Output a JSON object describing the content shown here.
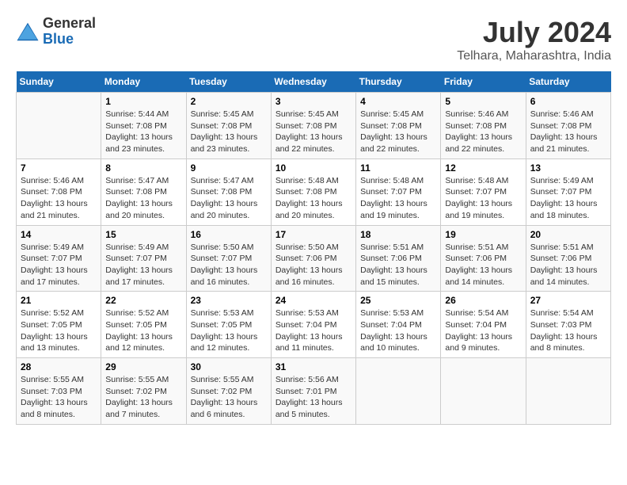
{
  "header": {
    "logo_general": "General",
    "logo_blue": "Blue",
    "main_title": "July 2024",
    "sub_title": "Telhara, Maharashtra, India"
  },
  "calendar": {
    "days_of_week": [
      "Sunday",
      "Monday",
      "Tuesday",
      "Wednesday",
      "Thursday",
      "Friday",
      "Saturday"
    ],
    "weeks": [
      [
        {
          "day": "",
          "content": ""
        },
        {
          "day": "1",
          "content": "Sunrise: 5:44 AM\nSunset: 7:08 PM\nDaylight: 13 hours\nand 23 minutes."
        },
        {
          "day": "2",
          "content": "Sunrise: 5:45 AM\nSunset: 7:08 PM\nDaylight: 13 hours\nand 23 minutes."
        },
        {
          "day": "3",
          "content": "Sunrise: 5:45 AM\nSunset: 7:08 PM\nDaylight: 13 hours\nand 22 minutes."
        },
        {
          "day": "4",
          "content": "Sunrise: 5:45 AM\nSunset: 7:08 PM\nDaylight: 13 hours\nand 22 minutes."
        },
        {
          "day": "5",
          "content": "Sunrise: 5:46 AM\nSunset: 7:08 PM\nDaylight: 13 hours\nand 22 minutes."
        },
        {
          "day": "6",
          "content": "Sunrise: 5:46 AM\nSunset: 7:08 PM\nDaylight: 13 hours\nand 21 minutes."
        }
      ],
      [
        {
          "day": "7",
          "content": "Sunrise: 5:46 AM\nSunset: 7:08 PM\nDaylight: 13 hours\nand 21 minutes."
        },
        {
          "day": "8",
          "content": "Sunrise: 5:47 AM\nSunset: 7:08 PM\nDaylight: 13 hours\nand 20 minutes."
        },
        {
          "day": "9",
          "content": "Sunrise: 5:47 AM\nSunset: 7:08 PM\nDaylight: 13 hours\nand 20 minutes."
        },
        {
          "day": "10",
          "content": "Sunrise: 5:48 AM\nSunset: 7:08 PM\nDaylight: 13 hours\nand 20 minutes."
        },
        {
          "day": "11",
          "content": "Sunrise: 5:48 AM\nSunset: 7:07 PM\nDaylight: 13 hours\nand 19 minutes."
        },
        {
          "day": "12",
          "content": "Sunrise: 5:48 AM\nSunset: 7:07 PM\nDaylight: 13 hours\nand 19 minutes."
        },
        {
          "day": "13",
          "content": "Sunrise: 5:49 AM\nSunset: 7:07 PM\nDaylight: 13 hours\nand 18 minutes."
        }
      ],
      [
        {
          "day": "14",
          "content": "Sunrise: 5:49 AM\nSunset: 7:07 PM\nDaylight: 13 hours\nand 17 minutes."
        },
        {
          "day": "15",
          "content": "Sunrise: 5:49 AM\nSunset: 7:07 PM\nDaylight: 13 hours\nand 17 minutes."
        },
        {
          "day": "16",
          "content": "Sunrise: 5:50 AM\nSunset: 7:07 PM\nDaylight: 13 hours\nand 16 minutes."
        },
        {
          "day": "17",
          "content": "Sunrise: 5:50 AM\nSunset: 7:06 PM\nDaylight: 13 hours\nand 16 minutes."
        },
        {
          "day": "18",
          "content": "Sunrise: 5:51 AM\nSunset: 7:06 PM\nDaylight: 13 hours\nand 15 minutes."
        },
        {
          "day": "19",
          "content": "Sunrise: 5:51 AM\nSunset: 7:06 PM\nDaylight: 13 hours\nand 14 minutes."
        },
        {
          "day": "20",
          "content": "Sunrise: 5:51 AM\nSunset: 7:06 PM\nDaylight: 13 hours\nand 14 minutes."
        }
      ],
      [
        {
          "day": "21",
          "content": "Sunrise: 5:52 AM\nSunset: 7:05 PM\nDaylight: 13 hours\nand 13 minutes."
        },
        {
          "day": "22",
          "content": "Sunrise: 5:52 AM\nSunset: 7:05 PM\nDaylight: 13 hours\nand 12 minutes."
        },
        {
          "day": "23",
          "content": "Sunrise: 5:53 AM\nSunset: 7:05 PM\nDaylight: 13 hours\nand 12 minutes."
        },
        {
          "day": "24",
          "content": "Sunrise: 5:53 AM\nSunset: 7:04 PM\nDaylight: 13 hours\nand 11 minutes."
        },
        {
          "day": "25",
          "content": "Sunrise: 5:53 AM\nSunset: 7:04 PM\nDaylight: 13 hours\nand 10 minutes."
        },
        {
          "day": "26",
          "content": "Sunrise: 5:54 AM\nSunset: 7:04 PM\nDaylight: 13 hours\nand 9 minutes."
        },
        {
          "day": "27",
          "content": "Sunrise: 5:54 AM\nSunset: 7:03 PM\nDaylight: 13 hours\nand 8 minutes."
        }
      ],
      [
        {
          "day": "28",
          "content": "Sunrise: 5:55 AM\nSunset: 7:03 PM\nDaylight: 13 hours\nand 8 minutes."
        },
        {
          "day": "29",
          "content": "Sunrise: 5:55 AM\nSunset: 7:02 PM\nDaylight: 13 hours\nand 7 minutes."
        },
        {
          "day": "30",
          "content": "Sunrise: 5:55 AM\nSunset: 7:02 PM\nDaylight: 13 hours\nand 6 minutes."
        },
        {
          "day": "31",
          "content": "Sunrise: 5:56 AM\nSunset: 7:01 PM\nDaylight: 13 hours\nand 5 minutes."
        },
        {
          "day": "",
          "content": ""
        },
        {
          "day": "",
          "content": ""
        },
        {
          "day": "",
          "content": ""
        }
      ]
    ]
  }
}
